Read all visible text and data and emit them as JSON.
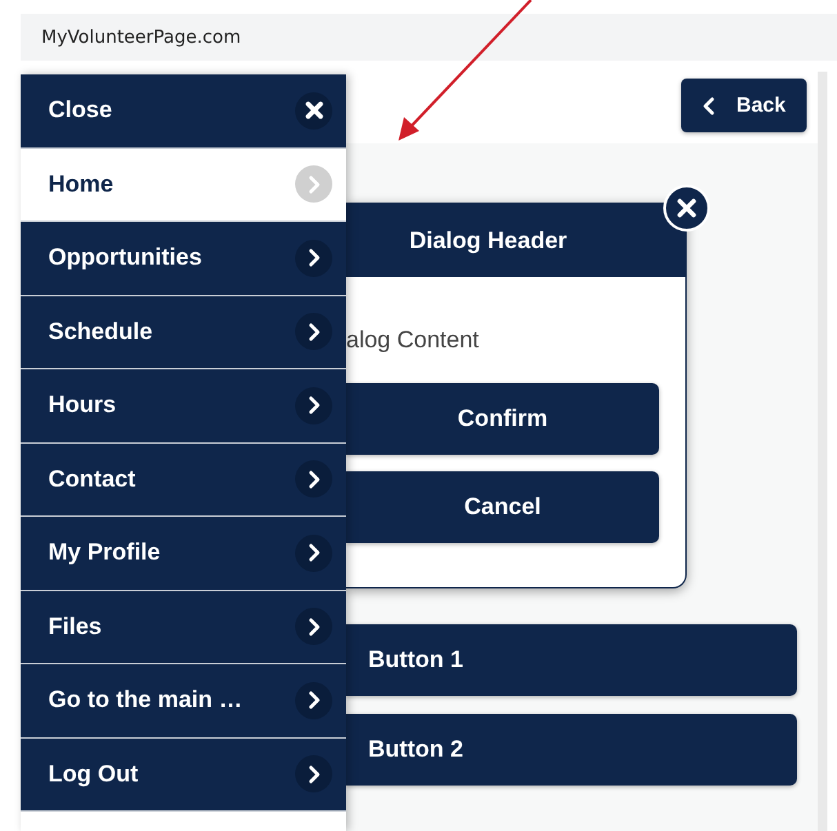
{
  "address_bar": {
    "url": "MyVolunteerPage.com"
  },
  "header": {
    "back_button": "Back"
  },
  "menu": {
    "close_label": "Close",
    "items": [
      {
        "label": "Home",
        "selected": true
      },
      {
        "label": "Opportunities",
        "selected": false
      },
      {
        "label": "Schedule",
        "selected": false
      },
      {
        "label": "Hours",
        "selected": false
      },
      {
        "label": "Contact",
        "selected": false
      },
      {
        "label": "My Profile",
        "selected": false
      },
      {
        "label": "Files",
        "selected": false
      },
      {
        "label": "Go to the main …",
        "selected": false
      },
      {
        "label": "Log Out",
        "selected": false
      }
    ]
  },
  "dialog": {
    "title": "Dialog Header",
    "content": "alog Content",
    "buttons": [
      "Confirm",
      "Cancel"
    ]
  },
  "page_buttons": [
    "Button 1",
    "Button 2"
  ]
}
